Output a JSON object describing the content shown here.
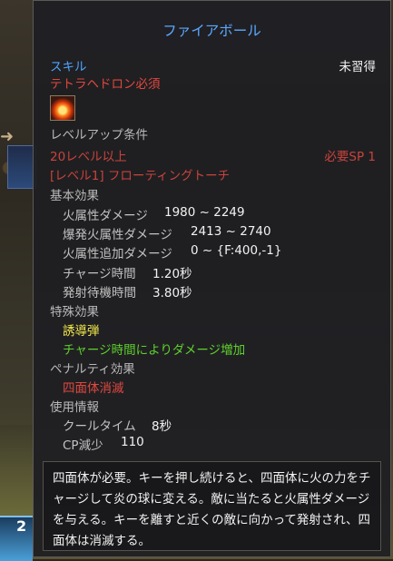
{
  "tooltip": {
    "title": "ファイアボール",
    "category": "スキル",
    "learn_status": "未習得",
    "requirement": "テトラヘドロン必須",
    "icon": "fire-skill-icon",
    "levelup_header": "レベルアップ条件",
    "level_req": "20レベル以上",
    "sp_req": "必要SP 1",
    "prereq_skill": "[レベル1] フローティングトーチ",
    "basic_effects": {
      "header": "基本効果",
      "rows": [
        {
          "label": "火属性ダメージ",
          "value": "1980 ~ 2249"
        },
        {
          "label": "爆発火属性ダメージ",
          "value": "2413 ~ 2740"
        },
        {
          "label": "火属性追加ダメージ",
          "value": "0 ~ {F:400,-1}"
        },
        {
          "label": "チャージ時間",
          "value": "1.20秒"
        },
        {
          "label": "発射待機時間",
          "value": "3.80秒"
        }
      ]
    },
    "special_effects": {
      "header": "特殊効果",
      "items": [
        "誘導弾",
        "チャージ時間によりダメージ増加"
      ]
    },
    "penalty": {
      "header": "ペナルティ効果",
      "items": [
        "四面体消滅"
      ]
    },
    "usage": {
      "header": "使用情報",
      "rows": [
        {
          "label": "クールタイム",
          "value": "8秒"
        },
        {
          "label": "CP減少",
          "value": "110"
        }
      ]
    },
    "description": "四面体が必要。キーを押し続けると、四面体に火の力をチャージして炎の球に変える。敵に当たると火属性ダメージを与える。キーを離すと近くの敵に向かって発射され、四面体は消滅する。"
  },
  "background": {
    "hotbar_number": "2"
  },
  "colors": {
    "title": "#5aa8ff",
    "category": "#4fa3ff",
    "warning": "#e0473f",
    "special": "#f0e84a",
    "green": "#5ed12b"
  }
}
